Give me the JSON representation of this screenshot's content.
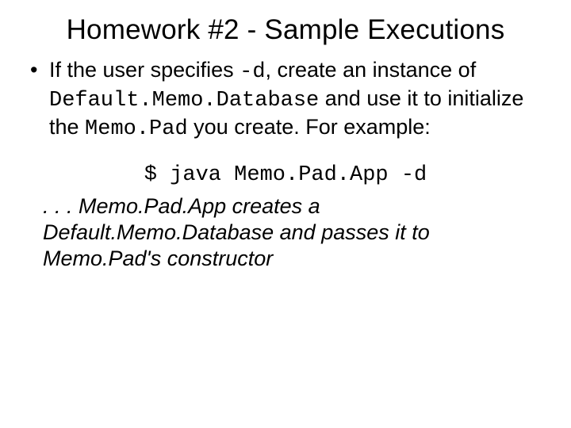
{
  "title": "Homework #2 - Sample Executions",
  "bullet": {
    "t1": "If the user specifies ",
    "flag": "-d",
    "t2": ", create an instance of ",
    "cls1": "Default.Memo.Database",
    "t3": " and use it to initialize the ",
    "cls2": "Memo.Pad",
    "t4": " you create. For example:"
  },
  "command": "$ java Memo.Pad.App -d",
  "explain": ". . . Memo.Pad.App creates a Default.Memo.Database and passes it to Memo.Pad's constructor"
}
